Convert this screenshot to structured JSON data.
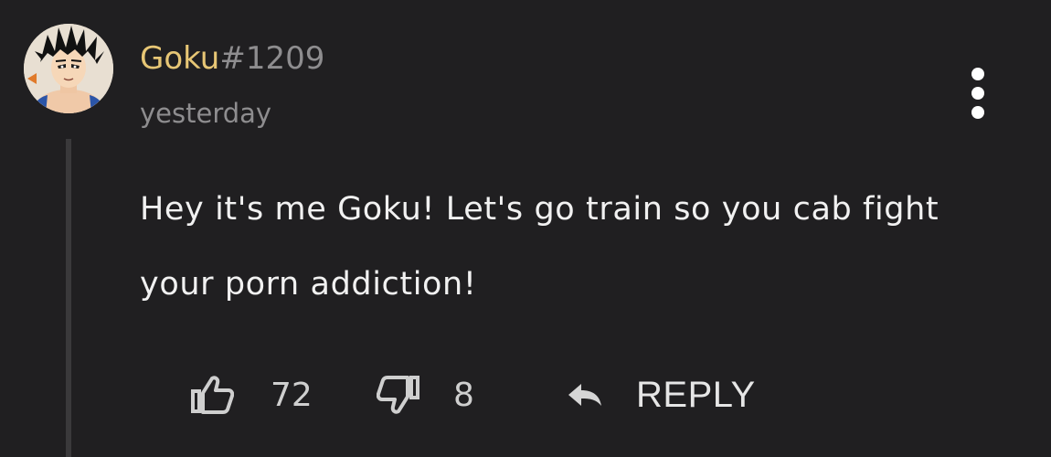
{
  "comment": {
    "author": {
      "name": "Goku",
      "tag": "#1209"
    },
    "timestamp": "yesterday",
    "body": "Hey it's me Goku! Let's go train so you cab fight your porn addiction!",
    "actions": {
      "upvote_count": "72",
      "downvote_count": "8",
      "reply_label": "REPLY"
    },
    "icons": {
      "avatar": "anime-character-avatar",
      "upvote": "thumbs-up-icon",
      "downvote": "thumbs-down-icon",
      "reply": "reply-arrow-icon",
      "menu": "more-vertical-icon"
    },
    "colors": {
      "background": "#201f21",
      "author_name": "#e7c675",
      "secondary_text": "#8e8d8f",
      "body_text": "#f1f1f1",
      "thread_line": "#3a393b"
    }
  }
}
